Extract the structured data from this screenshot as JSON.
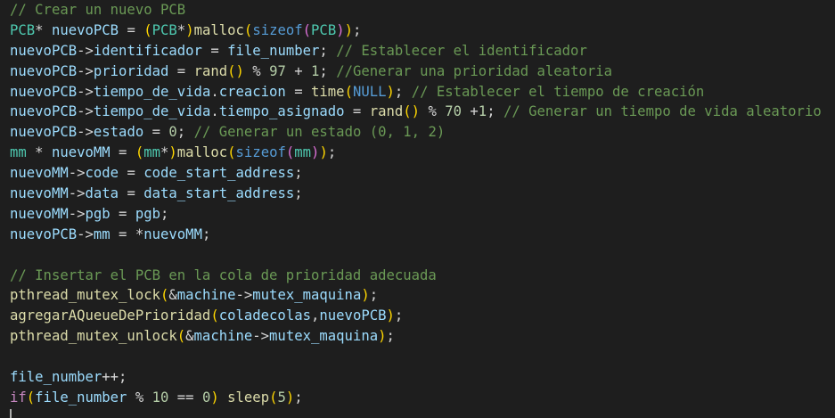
{
  "editor": {
    "colors": {
      "background": "#1e1e1e",
      "default": "#d4d4d4",
      "comment": "#6a9955",
      "type": "#4ec9b0",
      "variable": "#9cdcfe",
      "function": "#dcdcaa",
      "number": "#b5cea8",
      "keyword": "#569cd6",
      "control": "#c586c0",
      "bracket1": "#ffd700",
      "bracket2": "#da70d6",
      "bracket3": "#179fff"
    },
    "lines": [
      [
        [
          "// Crear un nuevo PCB",
          "comment"
        ]
      ],
      [
        [
          "PCB",
          "type"
        ],
        [
          "* ",
          "default"
        ],
        [
          "nuevoPCB",
          "variable"
        ],
        [
          " = ",
          "default"
        ],
        [
          "(",
          "bracket1"
        ],
        [
          "PCB",
          "type"
        ],
        [
          "*",
          "default"
        ],
        [
          ")",
          "bracket1"
        ],
        [
          "malloc",
          "function"
        ],
        [
          "(",
          "bracket1"
        ],
        [
          "sizeof",
          "keyword"
        ],
        [
          "(",
          "bracket2"
        ],
        [
          "PCB",
          "type"
        ],
        [
          ")",
          "bracket2"
        ],
        [
          ")",
          "bracket1"
        ],
        [
          ";",
          "default"
        ]
      ],
      [
        [
          "nuevoPCB",
          "variable"
        ],
        [
          "->",
          "default"
        ],
        [
          "identificador",
          "variable"
        ],
        [
          " = ",
          "default"
        ],
        [
          "file_number",
          "variable"
        ],
        [
          "; ",
          "default"
        ],
        [
          "// Establecer el identificador",
          "comment"
        ]
      ],
      [
        [
          "nuevoPCB",
          "variable"
        ],
        [
          "->",
          "default"
        ],
        [
          "prioridad",
          "variable"
        ],
        [
          " = ",
          "default"
        ],
        [
          "rand",
          "function"
        ],
        [
          "()",
          "bracket1"
        ],
        [
          " % ",
          "default"
        ],
        [
          "97",
          "number"
        ],
        [
          " + ",
          "default"
        ],
        [
          "1",
          "number"
        ],
        [
          "; ",
          "default"
        ],
        [
          "//Generar una prioridad aleatoria",
          "comment"
        ]
      ],
      [
        [
          "nuevoPCB",
          "variable"
        ],
        [
          "->",
          "default"
        ],
        [
          "tiempo_de_vida",
          "variable"
        ],
        [
          ".",
          "default"
        ],
        [
          "creacion",
          "variable"
        ],
        [
          " = ",
          "default"
        ],
        [
          "time",
          "function"
        ],
        [
          "(",
          "bracket1"
        ],
        [
          "NULL",
          "keyword"
        ],
        [
          ")",
          "bracket1"
        ],
        [
          "; ",
          "default"
        ],
        [
          "// Establecer el tiempo de creación",
          "comment"
        ]
      ],
      [
        [
          "nuevoPCB",
          "variable"
        ],
        [
          "->",
          "default"
        ],
        [
          "tiempo_de_vida",
          "variable"
        ],
        [
          ".",
          "default"
        ],
        [
          "tiempo_asignado",
          "variable"
        ],
        [
          " = ",
          "default"
        ],
        [
          "rand",
          "function"
        ],
        [
          "()",
          "bracket1"
        ],
        [
          " % ",
          "default"
        ],
        [
          "70",
          "number"
        ],
        [
          " +",
          "default"
        ],
        [
          "1",
          "number"
        ],
        [
          "; ",
          "default"
        ],
        [
          "// Generar un tiempo de vida aleatorio",
          "comment"
        ]
      ],
      [
        [
          "nuevoPCB",
          "variable"
        ],
        [
          "->",
          "default"
        ],
        [
          "estado",
          "variable"
        ],
        [
          " = ",
          "default"
        ],
        [
          "0",
          "number"
        ],
        [
          "; ",
          "default"
        ],
        [
          "// Generar un estado (0, 1, 2)",
          "comment"
        ]
      ],
      [
        [
          "mm",
          "type"
        ],
        [
          " * ",
          "default"
        ],
        [
          "nuevoMM",
          "variable"
        ],
        [
          " = ",
          "default"
        ],
        [
          "(",
          "bracket1"
        ],
        [
          "mm",
          "type"
        ],
        [
          "*",
          "default"
        ],
        [
          ")",
          "bracket1"
        ],
        [
          "malloc",
          "function"
        ],
        [
          "(",
          "bracket1"
        ],
        [
          "sizeof",
          "keyword"
        ],
        [
          "(",
          "bracket2"
        ],
        [
          "mm",
          "type"
        ],
        [
          ")",
          "bracket2"
        ],
        [
          ")",
          "bracket1"
        ],
        [
          ";",
          "default"
        ]
      ],
      [
        [
          "nuevoMM",
          "variable"
        ],
        [
          "->",
          "default"
        ],
        [
          "code",
          "variable"
        ],
        [
          " = ",
          "default"
        ],
        [
          "code_start_address",
          "variable"
        ],
        [
          ";",
          "default"
        ]
      ],
      [
        [
          "nuevoMM",
          "variable"
        ],
        [
          "->",
          "default"
        ],
        [
          "data",
          "variable"
        ],
        [
          " = ",
          "default"
        ],
        [
          "data_start_address",
          "variable"
        ],
        [
          ";",
          "default"
        ]
      ],
      [
        [
          "nuevoMM",
          "variable"
        ],
        [
          "->",
          "default"
        ],
        [
          "pgb",
          "variable"
        ],
        [
          " = ",
          "default"
        ],
        [
          "pgb",
          "variable"
        ],
        [
          ";",
          "default"
        ]
      ],
      [
        [
          "nuevoPCB",
          "variable"
        ],
        [
          "->",
          "default"
        ],
        [
          "mm",
          "variable"
        ],
        [
          " = *",
          "default"
        ],
        [
          "nuevoMM",
          "variable"
        ],
        [
          ";",
          "default"
        ]
      ],
      [],
      [
        [
          "// Insertar el PCB en la cola de prioridad adecuada",
          "comment"
        ]
      ],
      [
        [
          "pthread_mutex_lock",
          "function"
        ],
        [
          "(",
          "bracket1"
        ],
        [
          "&",
          "default"
        ],
        [
          "machine",
          "variable"
        ],
        [
          "->",
          "default"
        ],
        [
          "mutex_maquina",
          "variable"
        ],
        [
          ")",
          "bracket1"
        ],
        [
          ";",
          "default"
        ]
      ],
      [
        [
          "agregarAQueueDePrioridad",
          "function"
        ],
        [
          "(",
          "bracket1"
        ],
        [
          "coladecolas",
          "variable"
        ],
        [
          ",",
          "default"
        ],
        [
          "nuevoPCB",
          "variable"
        ],
        [
          ")",
          "bracket1"
        ],
        [
          ";",
          "default"
        ]
      ],
      [
        [
          "pthread_mutex_unlock",
          "function"
        ],
        [
          "(",
          "bracket1"
        ],
        [
          "&",
          "default"
        ],
        [
          "machine",
          "variable"
        ],
        [
          "->",
          "default"
        ],
        [
          "mutex_maquina",
          "variable"
        ],
        [
          ")",
          "bracket1"
        ],
        [
          ";",
          "default"
        ]
      ],
      [],
      [
        [
          "file_number",
          "variable"
        ],
        [
          "++;",
          "default"
        ]
      ],
      [
        [
          "if",
          "control"
        ],
        [
          "(",
          "bracket1"
        ],
        [
          "file_number",
          "variable"
        ],
        [
          " % ",
          "default"
        ],
        [
          "10",
          "number"
        ],
        [
          " == ",
          "default"
        ],
        [
          "0",
          "number"
        ],
        [
          ")",
          "bracket1"
        ],
        [
          " ",
          "default"
        ],
        [
          "sleep",
          "function"
        ],
        [
          "(",
          "bracket1"
        ],
        [
          "5",
          "number"
        ],
        [
          ")",
          "bracket1"
        ],
        [
          ";",
          "default"
        ]
      ]
    ]
  }
}
